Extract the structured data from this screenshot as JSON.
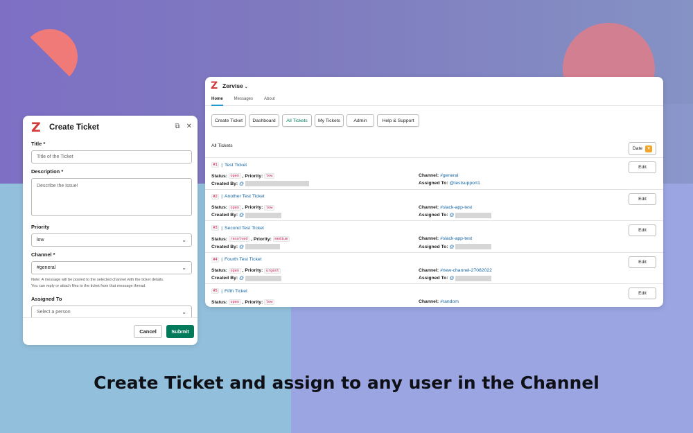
{
  "modal": {
    "title": "Create Ticket",
    "logo": "Z",
    "fields": {
      "title_label": "Title *",
      "title_placeholder": "Title of the Ticket",
      "description_label": "Description *",
      "description_placeholder": "Describe the issue!",
      "priority_label": "Priority",
      "priority_value": "low",
      "channel_label": "Channel *",
      "channel_value": "#general",
      "note_line1": "Note: A message will be posted to the selected channel with the ticket details.",
      "note_line2": "You can reply or attach files to the ticket from that message thread.",
      "assigned_label": "Assigned To",
      "assigned_placeholder": "Select a person"
    },
    "cancel_label": "Cancel",
    "submit_label": "Submit"
  },
  "app": {
    "name": "Zervise",
    "tabs": [
      "Home",
      "Messages",
      "About"
    ],
    "toolbar": [
      "Create Ticket",
      "Dashboard",
      "All Tickets",
      "My Tickets",
      "Admin",
      "Help & Support"
    ],
    "section_title": "All Tickets",
    "date_label": "Date",
    "edit_label": "Edit",
    "labels": {
      "status": "Status:",
      "priority": ", Priority:",
      "created_by": "Created By:",
      "channel": "Channel:",
      "assigned_to": "Assigned To:",
      "at": "@"
    },
    "tickets": [
      {
        "id": "#1",
        "title": "Test Ticket",
        "status": "open",
        "priority": "low",
        "channel": "#general",
        "assigned": "@testsupport1"
      },
      {
        "id": "#2",
        "title": "Another Test Ticket",
        "status": "open",
        "priority": "low",
        "channel": "#slack-app-test",
        "assigned": "@"
      },
      {
        "id": "#3",
        "title": "Second Test Ticket",
        "status": "resolved",
        "priority": "medium",
        "channel": "#slack-app-test",
        "assigned": "@"
      },
      {
        "id": "#4",
        "title": "Fourth Test Ticket",
        "status": "open",
        "priority": "urgent",
        "channel": "#new-channel-27082022",
        "assigned": "@"
      },
      {
        "id": "#5",
        "title": "Fifth Ticket",
        "status": "open",
        "priority": "low",
        "channel": "#random",
        "assigned": ""
      }
    ]
  },
  "caption": "Create Ticket and assign to any user in the Channel",
  "colors": {
    "accent_green": "#007a5a",
    "link_blue": "#1264a3",
    "code_red": "#cc2255",
    "deco_coral": "#f07a78",
    "deco_pink": "#d27f92"
  },
  "icons": [
    "external-link-icon",
    "close-icon",
    "chevron-down-icon",
    "sort-icon",
    "caret-down-icon"
  ]
}
